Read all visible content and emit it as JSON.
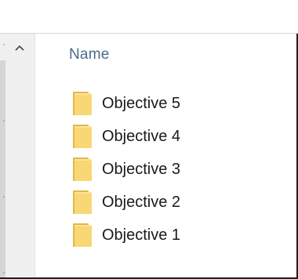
{
  "header": {
    "name_column": "Name"
  },
  "files": [
    {
      "name": "Objective 5",
      "icon": "folder-icon"
    },
    {
      "name": "Objective 4",
      "icon": "folder-icon"
    },
    {
      "name": "Objective 3",
      "icon": "folder-icon"
    },
    {
      "name": "Objective 2",
      "icon": "folder-icon"
    },
    {
      "name": "Objective 1",
      "icon": "folder-icon"
    }
  ],
  "colors": {
    "folder_fill": "#F8D775",
    "folder_edge": "#E2B84A",
    "header_text": "#4A6B8C"
  }
}
